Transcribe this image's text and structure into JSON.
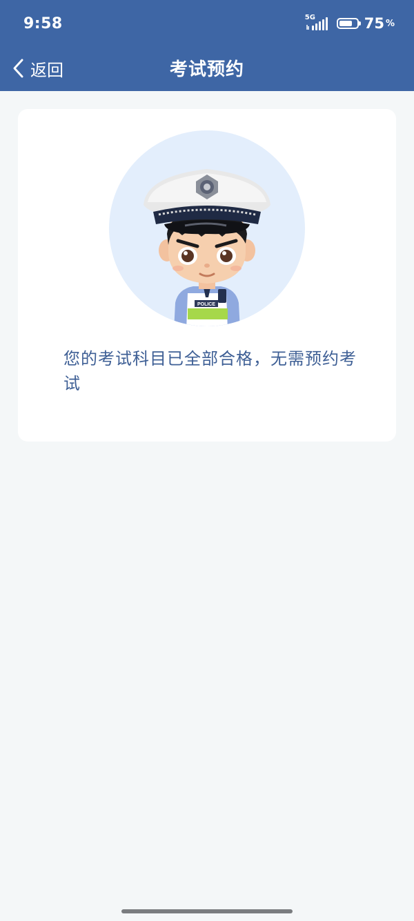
{
  "status_bar": {
    "time": "9:58",
    "network": "5G",
    "battery_percent_value": "75",
    "battery_percent_sign": "%",
    "battery_level": 0.75
  },
  "nav": {
    "back_label": "返回",
    "title": "考试预约"
  },
  "avatar": {
    "vest_label": "POLICE"
  },
  "message": "您的考试科目已全部合格，无需预约考试",
  "colors": {
    "header_bg": "#3e66a5",
    "message_text": "#3e5f95",
    "page_bg": "#f4f7f8",
    "avatar_bg": "#e3eefc"
  }
}
